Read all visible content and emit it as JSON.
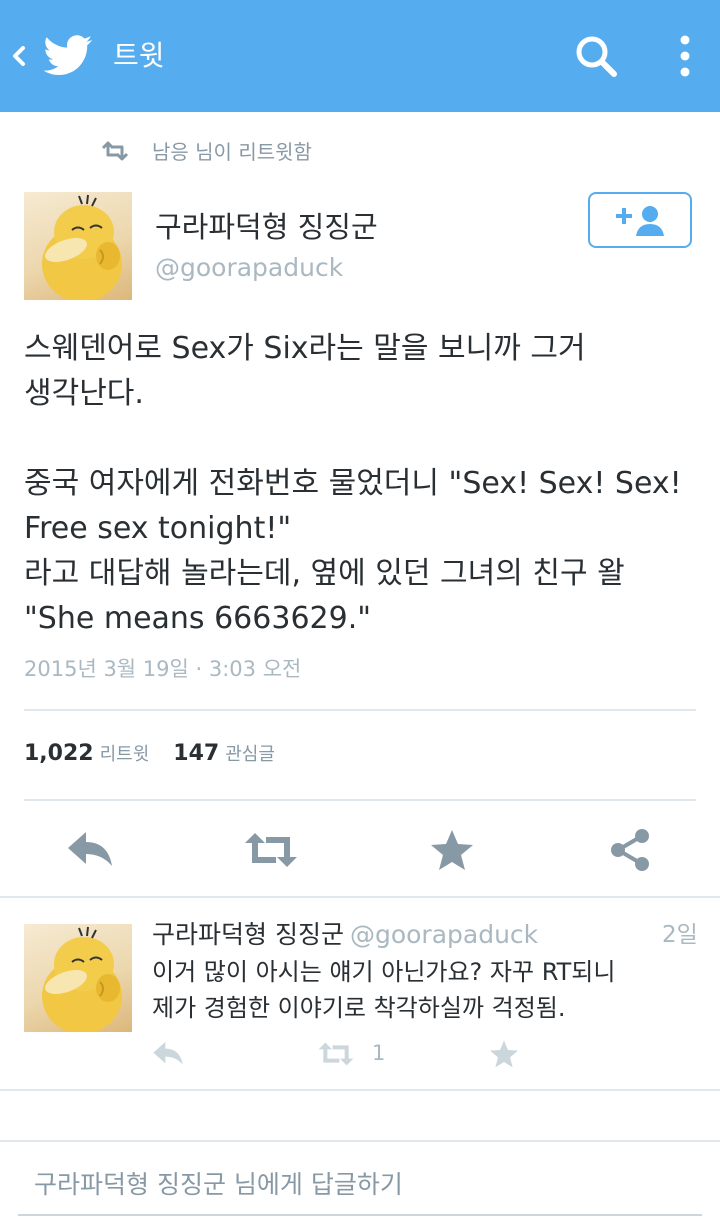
{
  "header": {
    "title": "트윗",
    "back_icon": "chevron-left-icon",
    "logo_icon": "twitter-bird-icon",
    "search_icon": "search-icon",
    "more_icon": "more-vertical-icon",
    "bg_color": "#55acee"
  },
  "retweet_context": {
    "text": "남응 님이 리트윗함",
    "icon": "retweet-icon"
  },
  "tweet": {
    "author_name": "구라파덕형 징징군",
    "author_handle": "@goorapaduck",
    "follow_icon": "add-user-icon",
    "lines": [
      "스웨덴어로 Sex가 Six라는 말을 보니까 그거",
      "생각난다.",
      "",
      "중국 여자에게 전화번호 물었더니 \"Sex! Sex! Sex!",
      "Free sex tonight!\"",
      "라고 대답해 놀라는데, 옆에 있던 그녀의 친구 왈",
      "\"She means 6663629.\""
    ],
    "timestamp": "2015년 3월 19일 · 3:03 오전",
    "retweet_count": "1,022",
    "retweet_label": "리트윗",
    "favorite_count": "147",
    "favorite_label": "관심글"
  },
  "actions": [
    {
      "name": "reply-icon"
    },
    {
      "name": "retweet-icon"
    },
    {
      "name": "star-icon"
    },
    {
      "name": "share-icon"
    }
  ],
  "reply": {
    "author_name": "구라파덕형 징징군",
    "author_handle": "@goorapaduck",
    "time": "2일",
    "lines": [
      "이거 많이 아시는 얘기 아닌가요? 자꾸 RT되니",
      "제가 경험한 이야기로 착각하실까 걱정됨."
    ],
    "retweet_count": "1"
  },
  "reply_box": {
    "placeholder": "구라파덕형 징징군 님에게 답글하기"
  },
  "colors": {
    "accent": "#55acee",
    "icon_gray": "#8899a6",
    "light_gray": "#aab8c2",
    "divider": "#e1e8ed"
  }
}
